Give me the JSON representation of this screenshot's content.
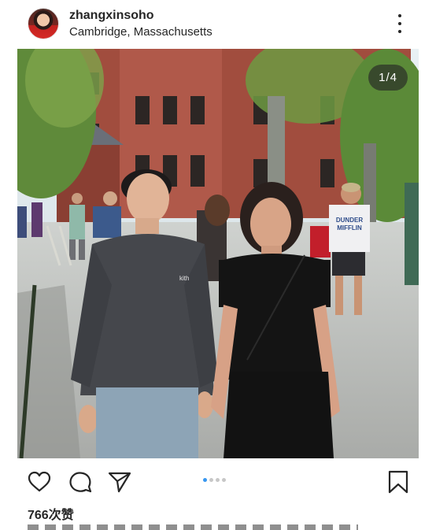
{
  "post": {
    "username": "zhangxinsoho",
    "location": "Cambridge, Massachusetts",
    "image_counter": "1/4",
    "likes_text": "766次赞"
  },
  "photo": {
    "shirt_text": "kith",
    "tshirt_text_line1": "DUNDER",
    "tshirt_text_line2": "MIFFLIN"
  },
  "carousel": {
    "total": 4,
    "current": 1
  },
  "icons": {
    "avatar": "profile-avatar",
    "more": "more-options-icon",
    "like": "heart-icon",
    "comment": "comment-bubble-icon",
    "share": "paper-plane-icon",
    "save": "bookmark-icon"
  },
  "colors": {
    "text": "#262626",
    "active_dot": "#3897f0",
    "inactive_dot": "#c7c7c7"
  }
}
